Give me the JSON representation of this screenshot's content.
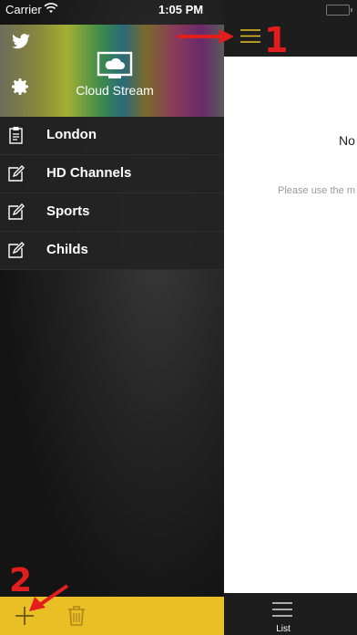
{
  "status_bar": {
    "carrier": "Carrier",
    "time": "1:05 PM"
  },
  "sidebar": {
    "app_title": "Cloud Stream",
    "icons": {
      "top": "twitter-icon",
      "settings": "gear-icon",
      "logo": "cloud-tv-icon"
    },
    "items": [
      {
        "label": "London",
        "icon": "clipboard-icon"
      },
      {
        "label": "HD Channels",
        "icon": "edit-icon"
      },
      {
        "label": "Sports",
        "icon": "edit-icon"
      },
      {
        "label": "Childs",
        "icon": "edit-icon"
      }
    ],
    "bottom_bar": {
      "add_icon": "plus-icon",
      "delete_icon": "trash-icon",
      "color": "#e8c026"
    }
  },
  "main": {
    "empty_title": "No",
    "empty_hint": "Please use the m",
    "tab_label": "List"
  },
  "annotations": {
    "one": "1",
    "two": "2",
    "color": "#e21d1d"
  },
  "colors": {
    "accent": "#e8c026",
    "dark": "#1d1d1d"
  }
}
